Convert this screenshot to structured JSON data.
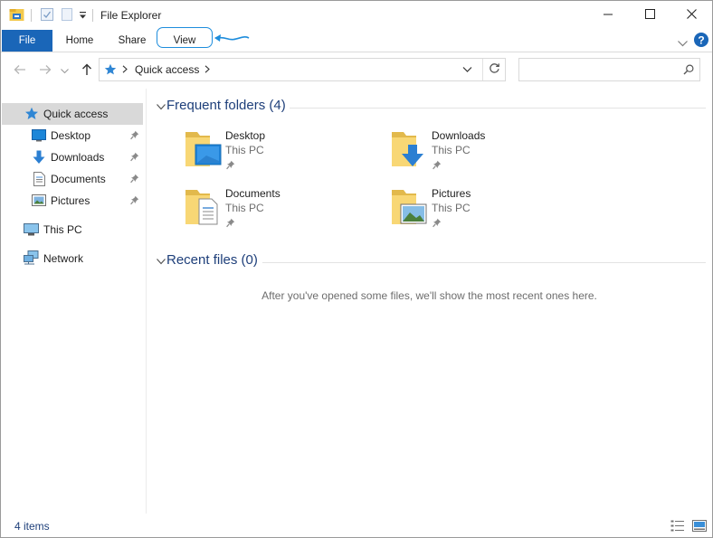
{
  "window": {
    "title": "File Explorer",
    "controls": [
      "minimize",
      "maximize",
      "close"
    ]
  },
  "ribbon": {
    "tabs": [
      {
        "label": "File"
      },
      {
        "label": "Home"
      },
      {
        "label": "Share"
      },
      {
        "label": "View"
      }
    ]
  },
  "address": {
    "location": "Quick access",
    "search_placeholder": ""
  },
  "navpane": {
    "items": [
      {
        "label": "Quick access",
        "icon": "star-icon",
        "selected": true
      },
      {
        "label": "Desktop",
        "icon": "desktop-icon",
        "pinned": true
      },
      {
        "label": "Downloads",
        "icon": "download-icon",
        "pinned": true
      },
      {
        "label": "Documents",
        "icon": "document-icon",
        "pinned": true
      },
      {
        "label": "Pictures",
        "icon": "pictures-icon",
        "pinned": true
      },
      {
        "label": "This PC",
        "icon": "computer-icon"
      },
      {
        "label": "Network",
        "icon": "network-icon"
      }
    ]
  },
  "frequent": {
    "title": "Frequent folders (4)",
    "folders": [
      {
        "name": "Desktop",
        "location": "This PC"
      },
      {
        "name": "Downloads",
        "location": "This PC"
      },
      {
        "name": "Documents",
        "location": "This PC"
      },
      {
        "name": "Pictures",
        "location": "This PC"
      }
    ]
  },
  "recent": {
    "title": "Recent files (0)",
    "empty_message": "After you've opened some files, we'll show the most recent ones here."
  },
  "status": {
    "items_count": "4 items"
  },
  "colors": {
    "accent": "#1a66b8",
    "highlight_ring": "#1e8ddc",
    "group_title": "#1e3f7a",
    "folder": "#f8d775"
  }
}
